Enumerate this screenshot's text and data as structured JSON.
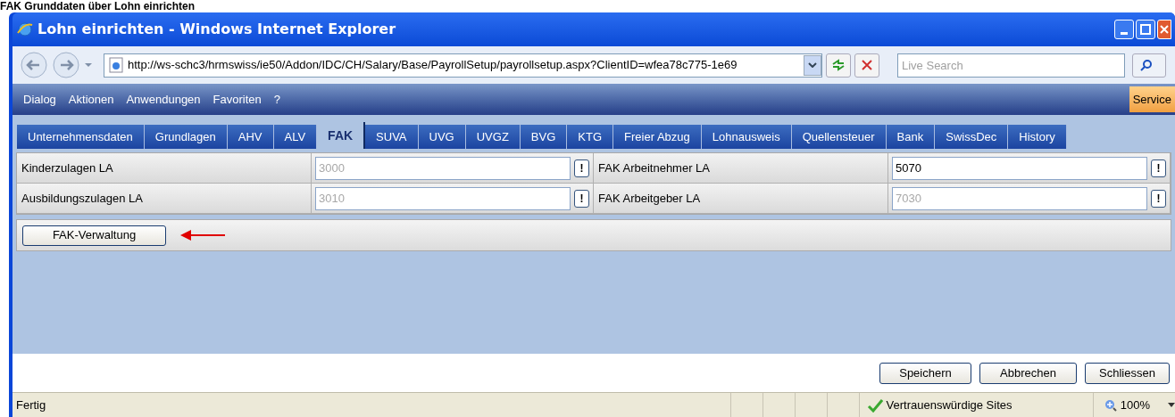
{
  "caption": "FAK Grunddaten über Lohn einrichten",
  "window": {
    "title": "Lohn einrichten - Windows Internet Explorer"
  },
  "address_bar": {
    "url": "http://ws-schc3/hrmswiss/ie50/Addon/IDC/CH/Salary/Base/PayrollSetup/payrollsetup.aspx?ClientID=wfea78c775-1e69"
  },
  "search": {
    "placeholder": "Live Search"
  },
  "menu": [
    "Dialog",
    "Aktionen",
    "Anwendungen",
    "Favoriten",
    "?"
  ],
  "service_button": "Service",
  "tabs": [
    {
      "label": "Unternehmensdaten",
      "selected": false
    },
    {
      "label": "Grundlagen",
      "selected": false
    },
    {
      "label": "AHV",
      "selected": false
    },
    {
      "label": "ALV",
      "selected": false
    },
    {
      "label": "FAK",
      "selected": true
    },
    {
      "label": "SUVA",
      "selected": false
    },
    {
      "label": "UVG",
      "selected": false
    },
    {
      "label": "UVGZ",
      "selected": false
    },
    {
      "label": "BVG",
      "selected": false
    },
    {
      "label": "KTG",
      "selected": false
    },
    {
      "label": "Freier Abzug",
      "selected": false
    },
    {
      "label": "Lohnausweis",
      "selected": false
    },
    {
      "label": "Quellensteuer",
      "selected": false
    },
    {
      "label": "Bank",
      "selected": false
    },
    {
      "label": "SwissDec",
      "selected": false
    },
    {
      "label": "History",
      "selected": false
    }
  ],
  "fields": [
    {
      "label": "Kinderzulagen LA",
      "value": "3000",
      "disabled": true
    },
    {
      "label": "FAK Arbeitnehmer LA",
      "value": "5070",
      "disabled": false
    },
    {
      "label": "Ausbildungszulagen LA",
      "value": "3010",
      "disabled": true
    },
    {
      "label": "FAK Arbeitgeber LA",
      "value": "7030",
      "disabled": true
    }
  ],
  "info_button": "!",
  "admin_button": "FAK-Verwaltung",
  "footer_buttons": [
    "Speichern",
    "Abbrechen",
    "Schliessen"
  ],
  "status_bar": {
    "status": "Fertig",
    "zone": "Vertrauenswürdige Sites",
    "zoom": "100%"
  }
}
